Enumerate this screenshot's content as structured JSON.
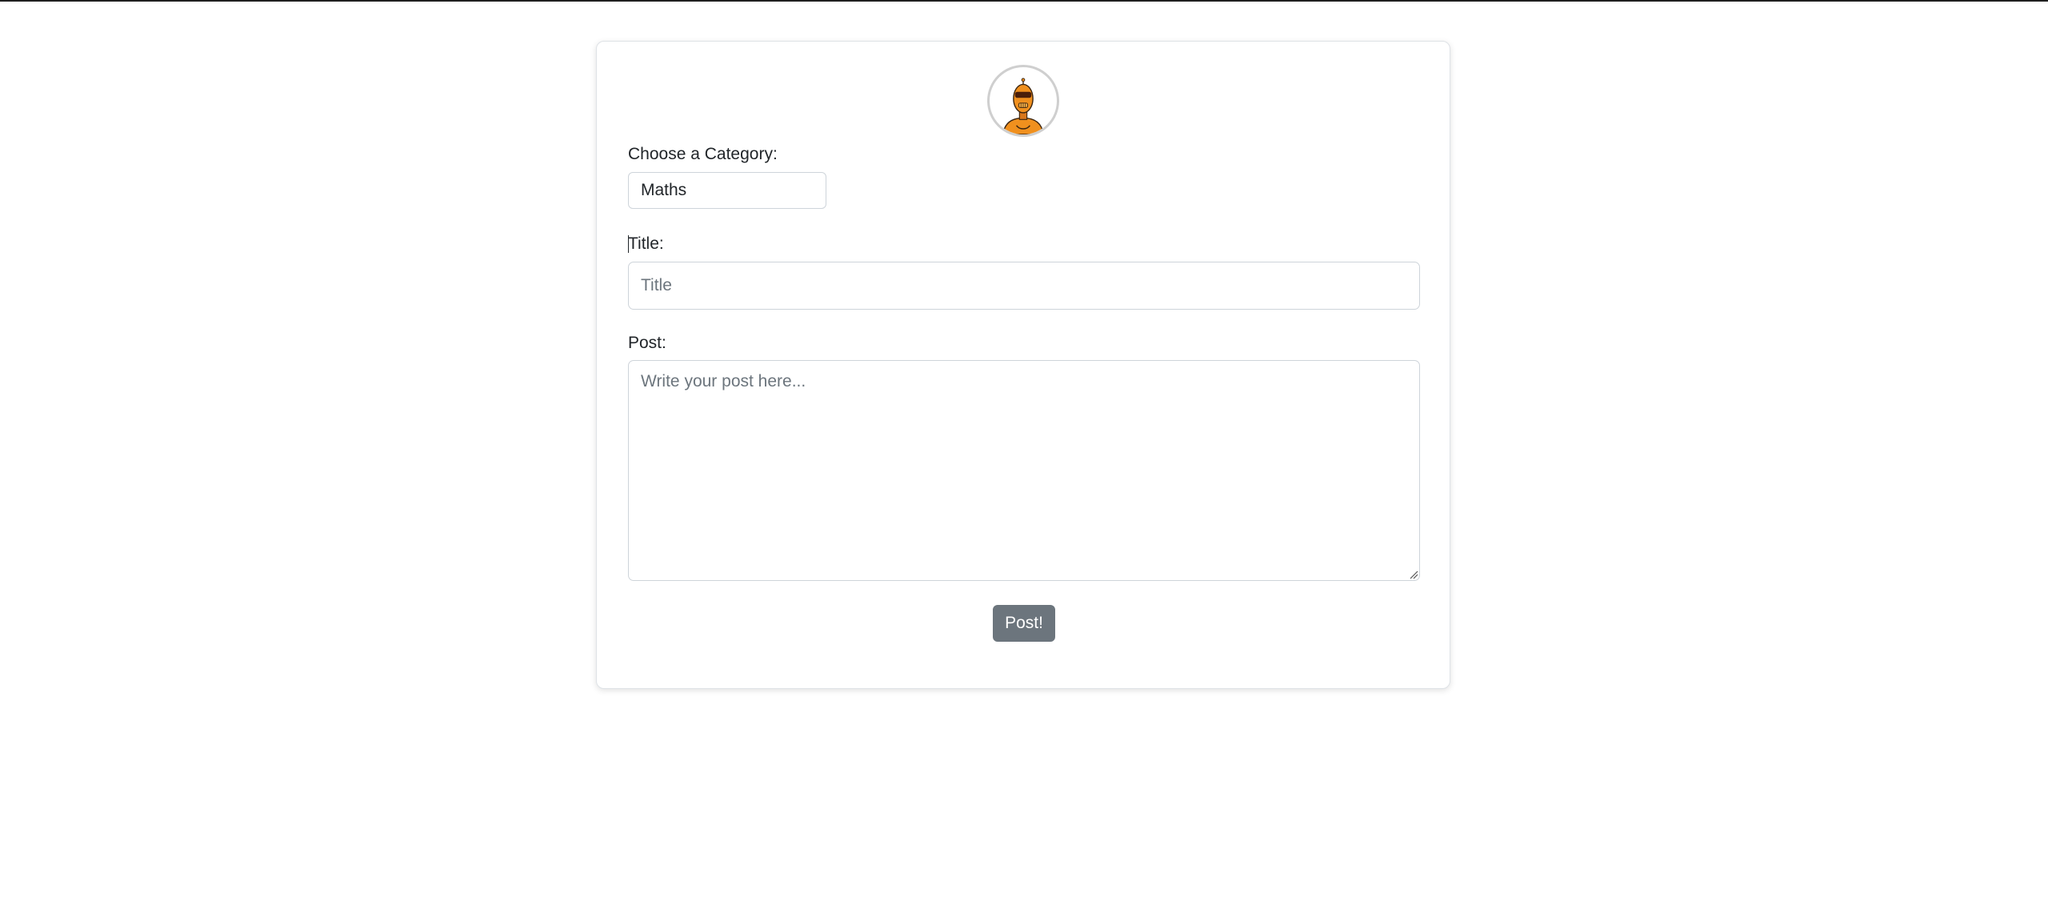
{
  "form": {
    "avatar_icon": "robot-avatar-icon",
    "category_label": "Choose a Category:",
    "category_selected": "Maths",
    "title_label": "Title:",
    "title_placeholder": "Title",
    "title_value": "",
    "post_label": "Post:",
    "post_placeholder": "Write your post here...",
    "post_value": "",
    "submit_label": "Post!"
  },
  "colors": {
    "button": "#6c757d",
    "border": "#ced4da",
    "avatar_accent": "#f0901e"
  }
}
